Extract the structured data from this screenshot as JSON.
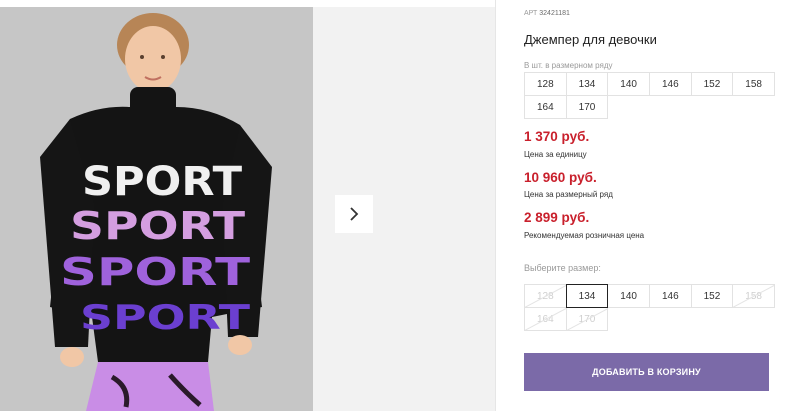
{
  "product": {
    "art_label": "АРТ",
    "art_number": "32421181",
    "title": "Джемпер для девочки"
  },
  "sizes_in_row": {
    "label": "В шт. в размерном ряду",
    "sizes": [
      "128",
      "134",
      "140",
      "146",
      "152",
      "158",
      "164",
      "170"
    ]
  },
  "prices": {
    "unit_price": "1 370 руб.",
    "unit_label": "Цена за единицу",
    "row_price": "10 960 руб.",
    "row_label": "Цена за размерный ряд",
    "retail_price": "2 899 руб.",
    "retail_label": "Рекомендуемая розничная цена"
  },
  "size_selector": {
    "label": "Выберите размер:",
    "options": [
      {
        "value": "128",
        "state": "disabled"
      },
      {
        "value": "134",
        "state": "selected"
      },
      {
        "value": "140",
        "state": "available"
      },
      {
        "value": "146",
        "state": "available"
      },
      {
        "value": "152",
        "state": "available"
      },
      {
        "value": "158",
        "state": "disabled"
      },
      {
        "value": "164",
        "state": "disabled"
      },
      {
        "value": "170",
        "state": "disabled"
      }
    ]
  },
  "cart_button": {
    "label": "ДОБАВИТЬ В КОРЗИНУ",
    "color": "#7b6aa8"
  },
  "gallery": {
    "next_icon": "chevron-right-icon",
    "sweater_print_text": "SPORT"
  },
  "colors": {
    "price": "#c9202c",
    "accent": "#7b6aa8"
  }
}
